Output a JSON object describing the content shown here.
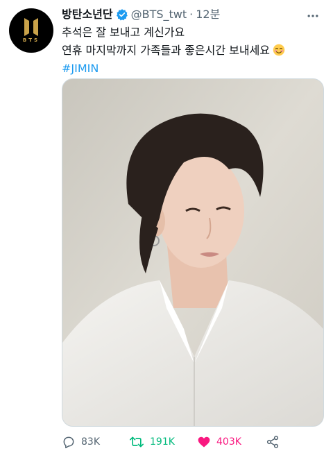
{
  "tweet": {
    "author": {
      "display_name": "방탄소년단",
      "handle": "@BTS_twt",
      "verified": true,
      "avatar_logo_text": "BTS",
      "avatar_icon": "bts-logo-icon"
    },
    "separator": "·",
    "time": "12분",
    "text_lines": [
      "추석은 잘 보내고 계신가요",
      "연휴 마지막까지 가족들과 좋은시간 보내세요"
    ],
    "emoji": "smiling-face-icon",
    "hashtag": "#JIMIN",
    "media": {
      "description_icon": "photo-image"
    },
    "actions": {
      "reply_count": "83K",
      "retweet_count": "191K",
      "like_count": "403K"
    }
  },
  "colors": {
    "accent": "#1d9bf0",
    "retweet": "#00ba7c",
    "like": "#f91880",
    "muted": "#536471",
    "text": "#0f1419"
  }
}
